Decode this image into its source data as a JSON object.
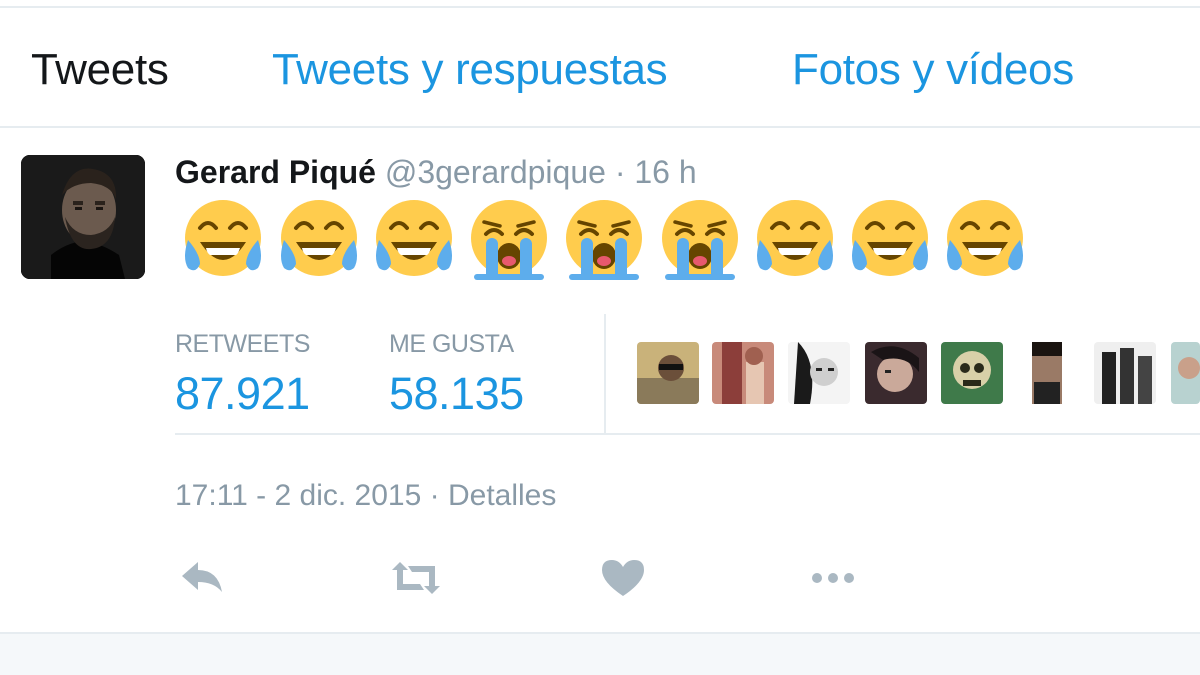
{
  "tabs": [
    {
      "label": "Tweets",
      "active": true
    },
    {
      "label": "Tweets y respuestas",
      "active": false
    },
    {
      "label": "Fotos y vídeos",
      "active": false
    }
  ],
  "tweet": {
    "author_name": "Gerard Piqué",
    "handle": "@3gerardpique",
    "separator": "·",
    "time_ago": "16 h",
    "emojis": [
      "face-with-tears-of-joy",
      "face-with-tears-of-joy",
      "face-with-tears-of-joy",
      "loudly-crying-face",
      "loudly-crying-face",
      "loudly-crying-face",
      "face-with-tears-of-joy",
      "face-with-tears-of-joy",
      "face-with-tears-of-joy"
    ],
    "stats": {
      "retweets_label": "RETWEETS",
      "retweets_value": "87.921",
      "likes_label": "ME GUSTA",
      "likes_value": "58.135"
    },
    "timestamp": "17:11 - 2 dic. 2015",
    "details_label": "Detalles",
    "actions": [
      "reply-icon",
      "retweet-icon",
      "heart-icon",
      "more-icon"
    ]
  },
  "colors": {
    "link_blue": "#1b95e0",
    "muted_gray": "#8899a6",
    "text_dark": "#14171a",
    "border": "#e6ecf0",
    "emoji_yellow": "#ffcc4d",
    "tear_blue": "#5dadec"
  }
}
